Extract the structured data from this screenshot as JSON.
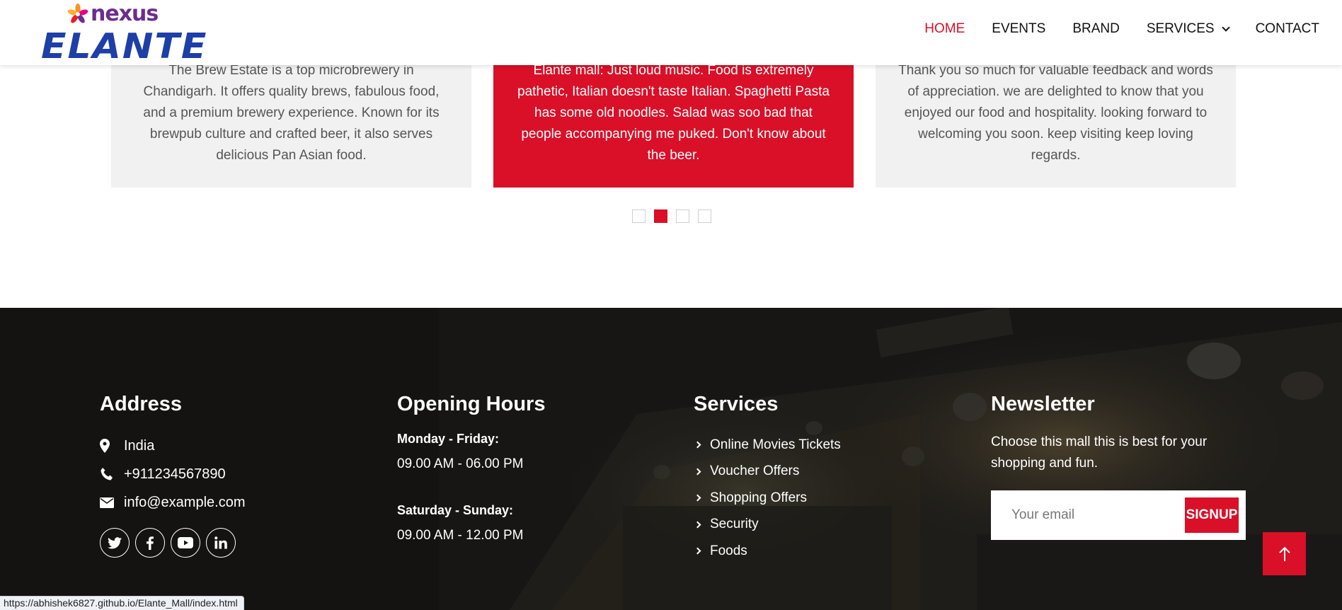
{
  "header": {
    "logo_top": "nexus",
    "logo_main": "ELANTE",
    "nav": [
      {
        "label": "HOME",
        "active": true
      },
      {
        "label": "EVENTS",
        "active": false
      },
      {
        "label": "BRAND",
        "active": false
      },
      {
        "label": "SERVICES",
        "active": false,
        "has_dropdown": true
      },
      {
        "label": "CONTACT",
        "active": false
      }
    ]
  },
  "reviews": {
    "cards": [
      {
        "text": "The Brew Estate is a top microbrewery in Chandigarh. It offers quality brews, fabulous food, and a premium brewery experience. Known for its brewpub culture and crafted beer, it also serves delicious Pan Asian food.",
        "active": false
      },
      {
        "text": "Elante mall: Just loud music. Food is extremely pathetic, Italian doesn't taste Italian. Spaghetti Pasta has some old noodles. Salad was soo bad that people accompanying me puked. Don't know about the beer.",
        "active": true
      },
      {
        "text": "Thank you so much for valuable feedback and words of appreciation. we are delighted to know that you enjoyed our food and hospitality. looking forward to welcoming you soon. keep visiting keep loving regards.",
        "active": false
      }
    ],
    "active_dot": 2,
    "dot_count": 4
  },
  "footer": {
    "address": {
      "title": "Address",
      "location": "India",
      "phone": "+911234567890",
      "email": "info@example.com",
      "social": [
        "twitter-icon",
        "facebook-icon",
        "youtube-icon",
        "linkedin-icon"
      ]
    },
    "hours": {
      "title": "Opening Hours",
      "weekday_label": "Monday - Friday:",
      "weekday_time": "09.00 AM - 06.00 PM",
      "weekend_label": "Saturday - Sunday:",
      "weekend_time": "09.00 AM - 12.00 PM"
    },
    "services": {
      "title": "Services",
      "items": [
        "Online Movies Tickets",
        "Voucher Offers",
        "Shopping Offers",
        "Security",
        "Foods"
      ]
    },
    "newsletter": {
      "title": "Newsletter",
      "text": "Choose this mall this is best for your shopping and fun.",
      "placeholder": "Your email",
      "button": "SIGNUP"
    }
  },
  "status_bar_url": "https://abhishek6827.github.io/Elante_Mall/index.html",
  "colors": {
    "accent": "#d91028",
    "brand_blue": "#1e3fa8",
    "brand_purple": "#6b2c8f",
    "footer_bg": "#171615"
  }
}
